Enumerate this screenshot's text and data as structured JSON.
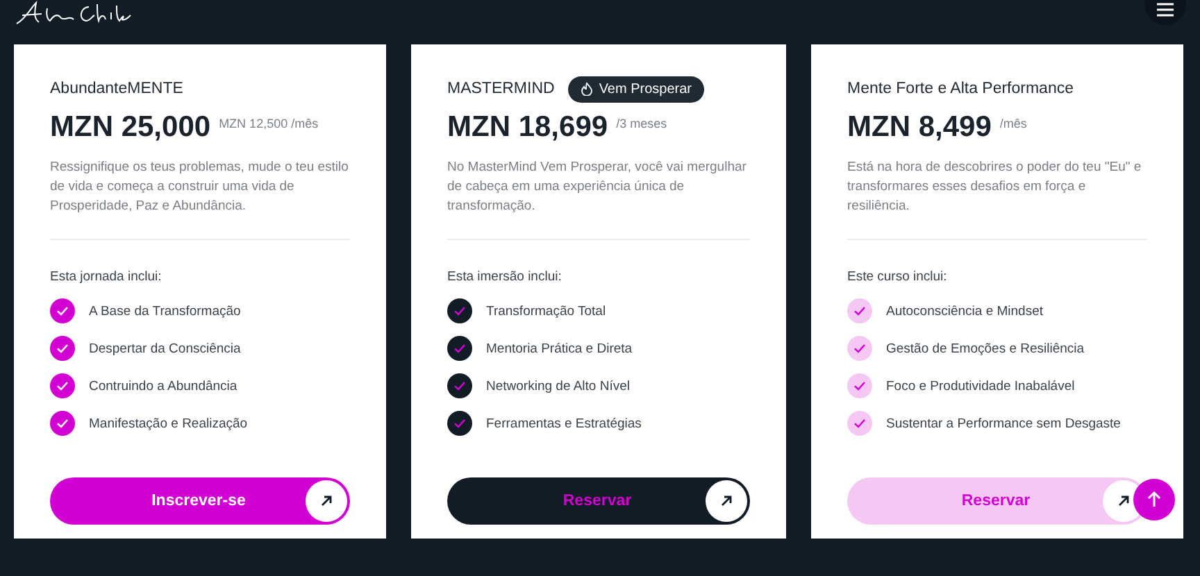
{
  "plans": [
    {
      "kind": "primary",
      "title": "AbundanteMENTE",
      "price": "MZN 25,000",
      "price_note": "MZN 12,500 /mês",
      "description": "Ressignifique os teus problemas, mude o teu estilo de vida e começa a construir uma vida de Prosperidade, Paz e Abundância.",
      "includes_label": "Esta jornada inclui:",
      "features": [
        "A Base da Transformação",
        "Despertar da Consciência",
        "Contruindo a Abundância",
        "Manifestação e Realização"
      ],
      "button": "Inscrever-se"
    },
    {
      "kind": "dark",
      "title": "MASTERMIND",
      "badge": "Vem Prosperar",
      "price": "MZN 18,699",
      "price_note": "/3 meses",
      "description": "No MasterMind Vem Prosperar, você vai mergulhar de cabeça em uma experiência única de transformação.",
      "includes_label": "Esta imersão inclui:",
      "features": [
        "Transformação Total",
        "Mentoria Prática e Direta",
        "Networking de Alto Nível",
        "Ferramentas e Estratégias"
      ],
      "button": "Reservar"
    },
    {
      "kind": "light",
      "title": "Mente Forte e Alta Performance",
      "price": "MZN 8,499",
      "price_note": "/mês",
      "description": "Está na hora de descobrires o poder do teu \"Eu\" e transformares esses desafios em força e resiliência.",
      "includes_label": "Este curso inclui:",
      "features": [
        "Autoconsciência e Mindset",
        "Gestão de Emoções e Resiliência",
        "Foco e Produtividade Inabalável",
        "Sustentar a Performance sem Desgaste"
      ],
      "button": "Reservar"
    }
  ]
}
